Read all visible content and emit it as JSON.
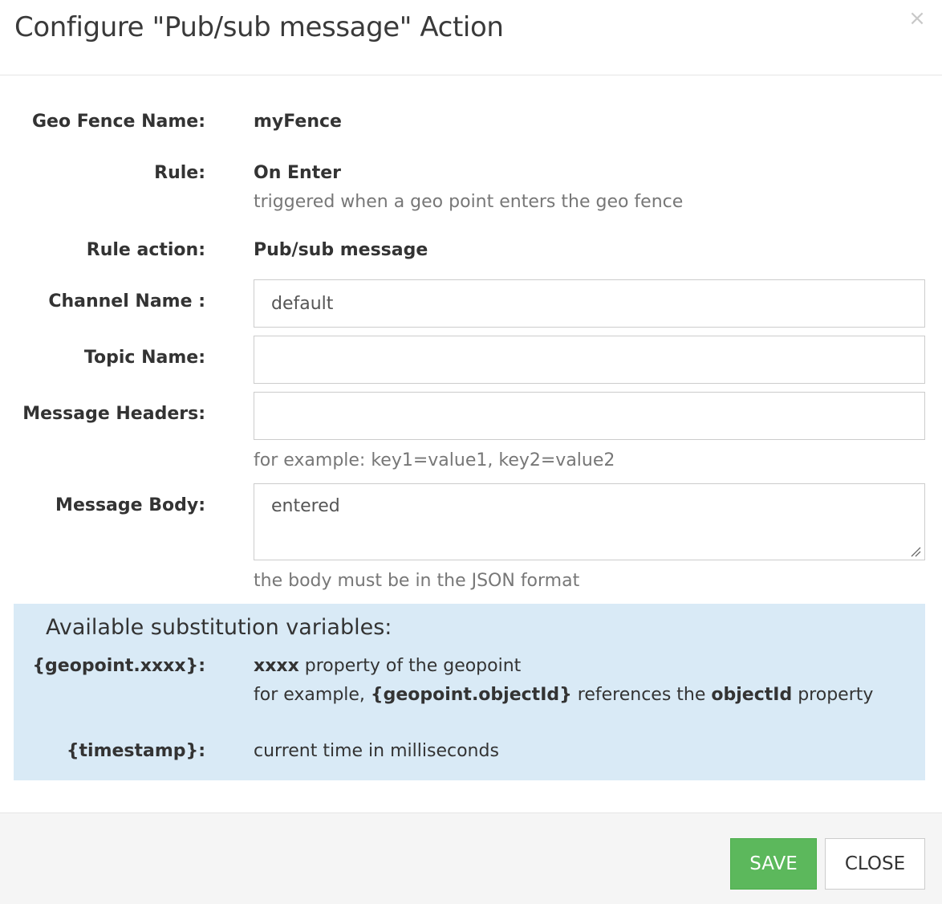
{
  "header": {
    "title": "Configure \"Pub/sub message\" Action",
    "close_glyph": "×"
  },
  "form": {
    "geo_fence_name": {
      "label": "Geo Fence Name:",
      "value": "myFence"
    },
    "rule": {
      "label": "Rule:",
      "value": "On Enter",
      "description": "triggered when a geo point enters the geo fence"
    },
    "rule_action": {
      "label": "Rule action:",
      "value": "Pub/sub message"
    },
    "channel_name": {
      "label": "Channel Name :",
      "value": "default",
      "placeholder": ""
    },
    "topic_name": {
      "label": "Topic Name:",
      "value": "",
      "placeholder": ""
    },
    "message_headers": {
      "label": "Message Headers:",
      "value": "",
      "placeholder": "",
      "help": "for example: key1=value1, key2=value2"
    },
    "message_body": {
      "label": "Message Body:",
      "value": "entered",
      "help": "the body must be in the JSON format"
    }
  },
  "substitution": {
    "title": "Available substitution variables:",
    "geopoint": {
      "label": "{geopoint.xxxx}:",
      "line1_bold": "xxxx",
      "line1_rest": " property of the geopoint",
      "line2_a": "for example, ",
      "line2_b_bold": "{geopoint.objectId}",
      "line2_c": " references the ",
      "line2_d_bold": "objectId",
      "line2_e": " property"
    },
    "timestamp": {
      "label": "{timestamp}:",
      "description": "current time in milliseconds"
    }
  },
  "footer": {
    "save_label": "SAVE",
    "close_label": "CLOSE"
  },
  "colors": {
    "save_button": "#5cb85c",
    "substitution_panel": "#d9eaf6",
    "footer_bg": "#f5f5f5",
    "help_text": "#777777"
  }
}
